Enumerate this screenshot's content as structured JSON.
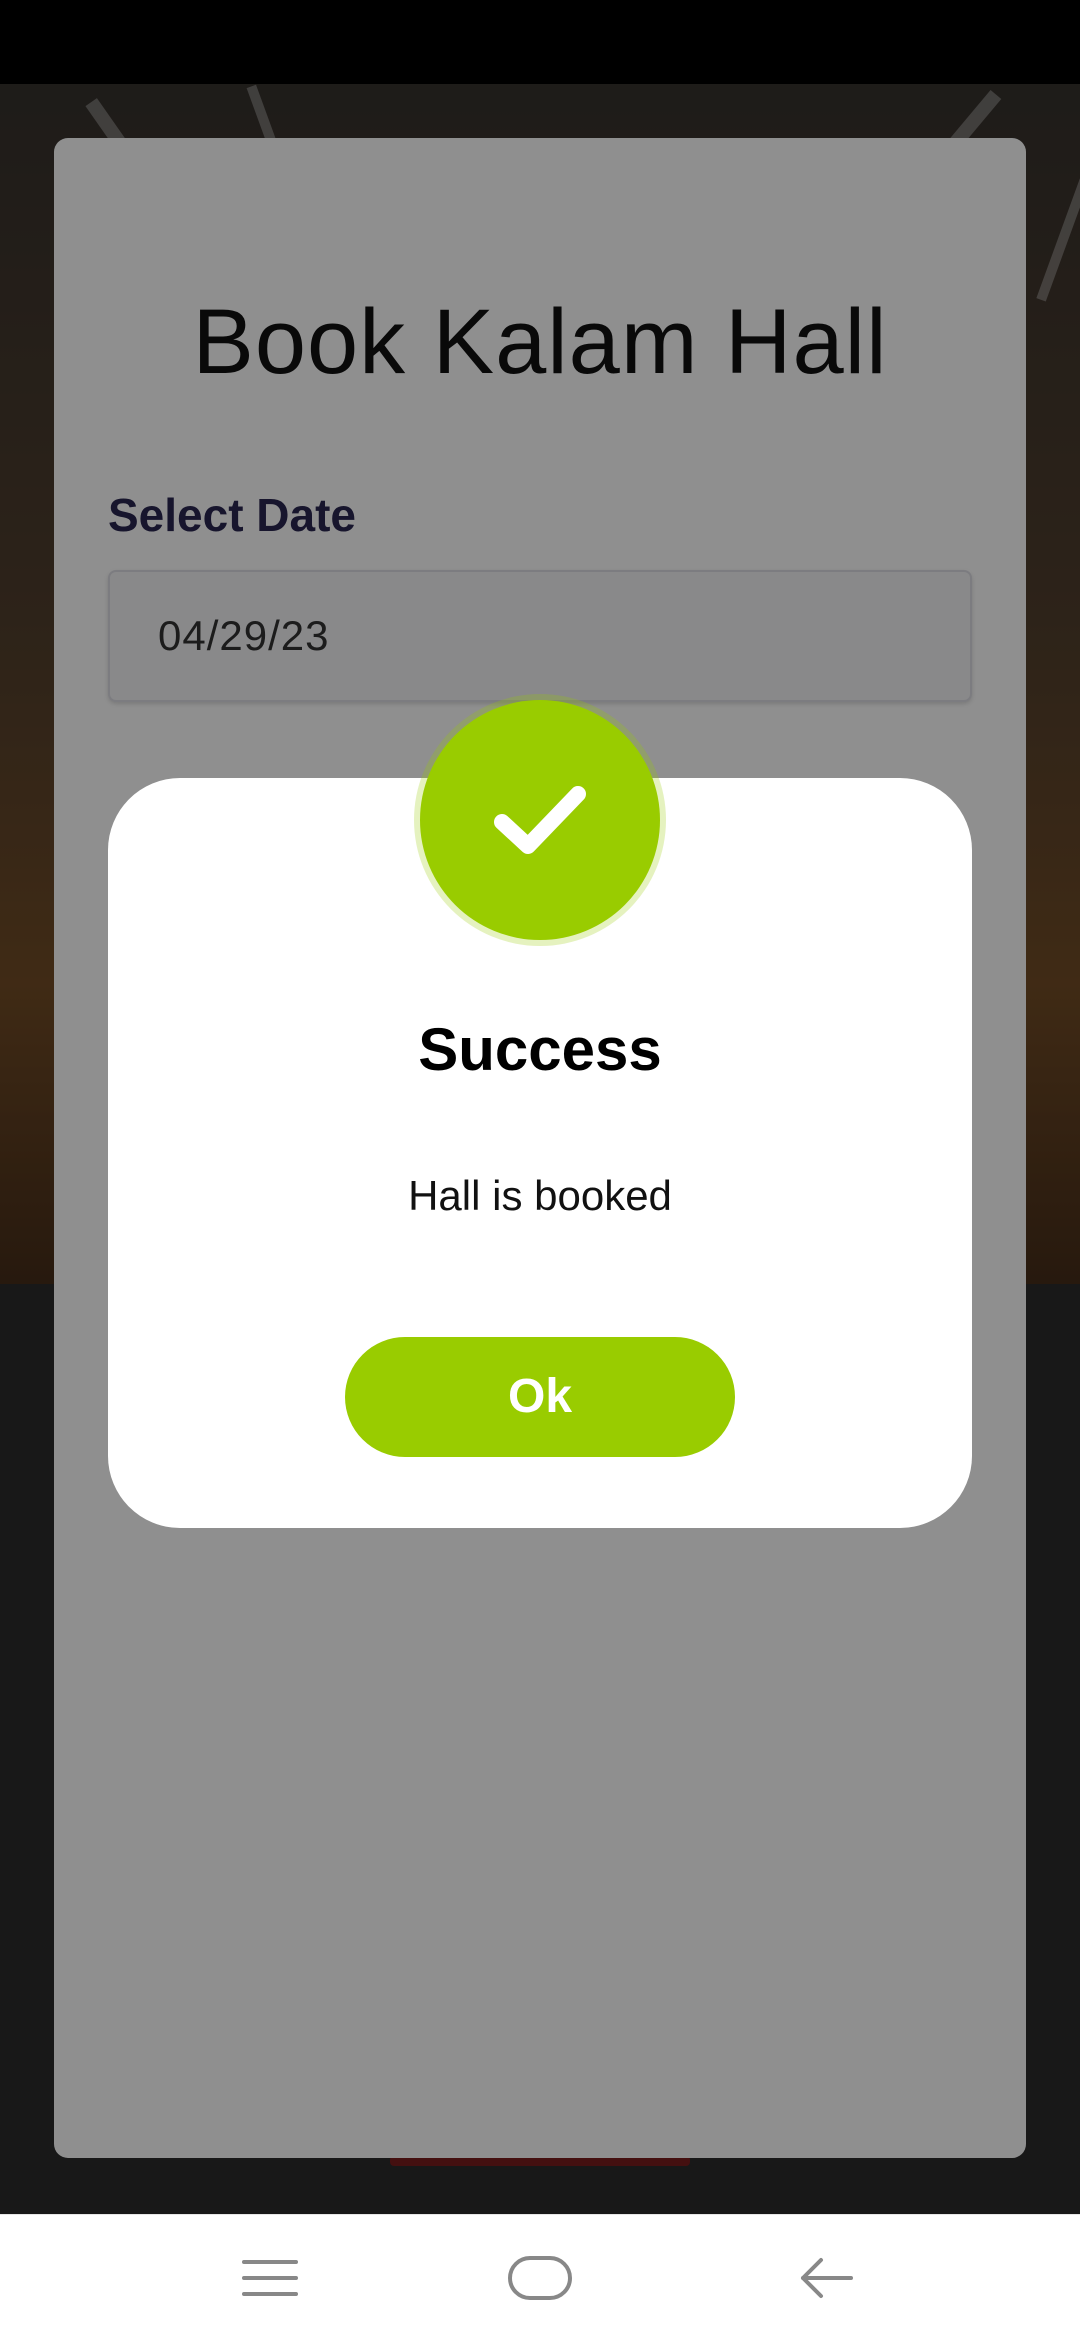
{
  "booking": {
    "title": "Book Kalam Hall",
    "date_label": "Select Date",
    "date_value": "04/29/23"
  },
  "dialog": {
    "icon": "check-icon",
    "title": "Success",
    "message": "Hall is booked",
    "ok_label": "Ok",
    "accent_color": "#99cc00"
  },
  "nav_bar": {
    "buttons": [
      "menu-icon",
      "home-icon",
      "back-icon"
    ]
  }
}
